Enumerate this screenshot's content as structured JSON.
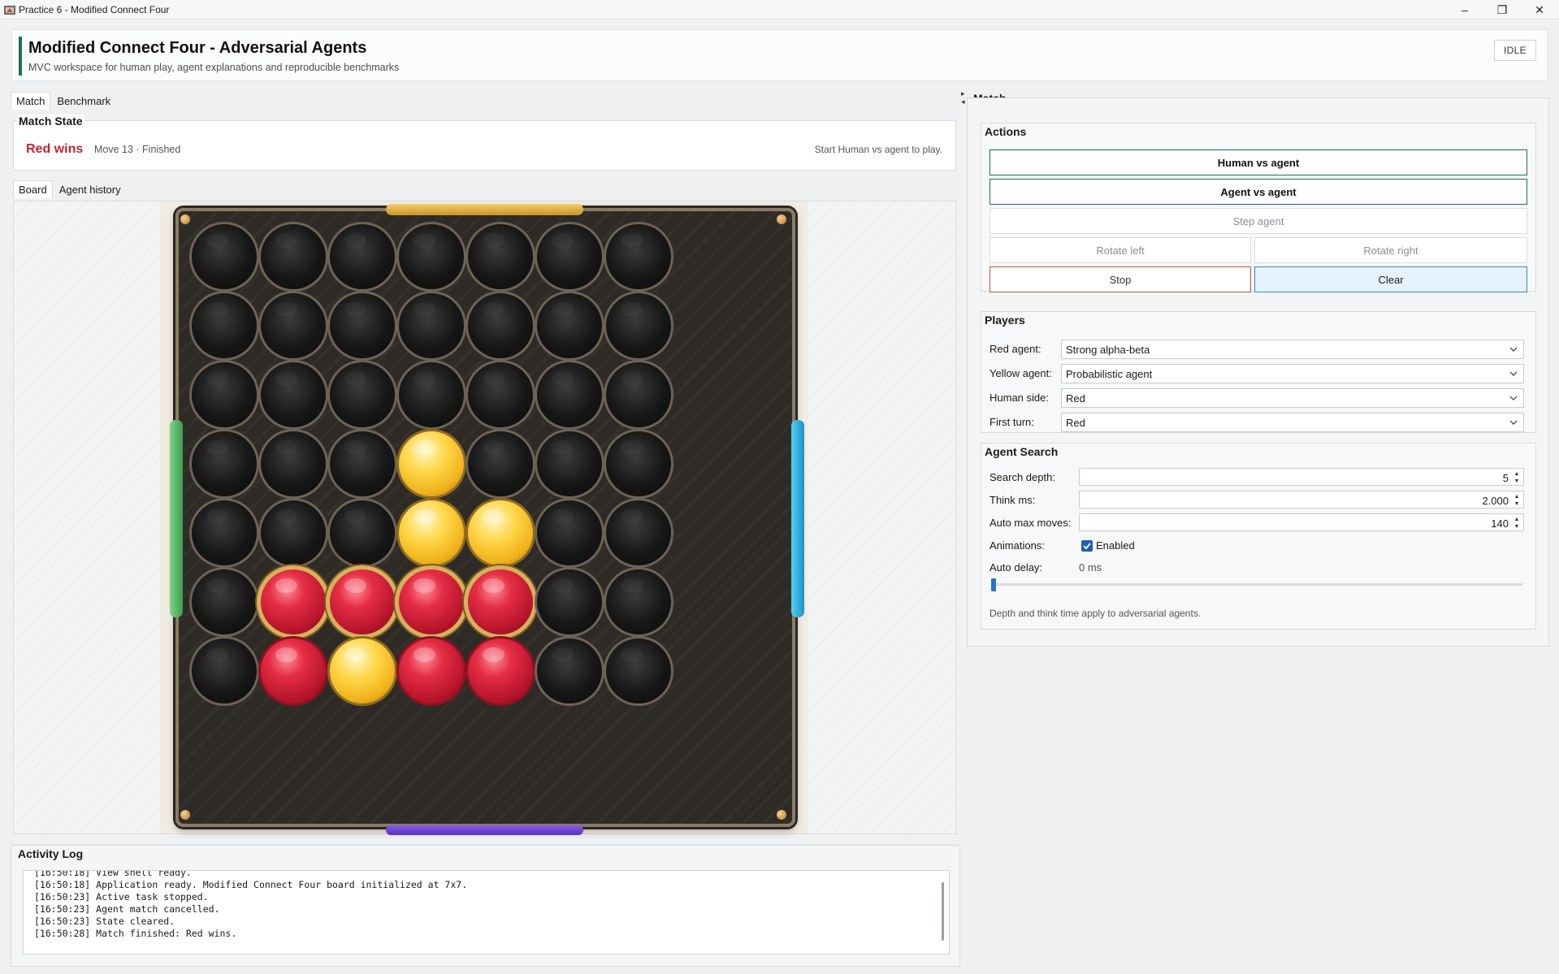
{
  "window": {
    "title": "Practice 6 - Modified Connect Four",
    "minimize": "–",
    "restore": "❐",
    "close": "✕"
  },
  "header": {
    "title": "Modified Connect Four - Adversarial Agents",
    "subtitle": "MVC workspace for human play, agent explanations and reproducible benchmarks",
    "status": "IDLE"
  },
  "main_tabs": [
    {
      "label": "Match"
    },
    {
      "label": "Benchmark"
    }
  ],
  "match_state": {
    "title": "Match State",
    "winner": "Red wins",
    "move_info": "Move 13 · Finished",
    "hint": "Start Human vs agent to play."
  },
  "board_tabs": [
    {
      "label": "Board"
    },
    {
      "label": "Agent history"
    }
  ],
  "board": {
    "columns": 7,
    "rows": 7,
    "grid": [
      [
        "e",
        "e",
        "e",
        "e",
        "e",
        "e",
        "e"
      ],
      [
        "e",
        "e",
        "e",
        "e",
        "e",
        "e",
        "e"
      ],
      [
        "e",
        "e",
        "e",
        "e",
        "e",
        "e",
        "e"
      ],
      [
        "e",
        "e",
        "e",
        "y",
        "e",
        "e",
        "e"
      ],
      [
        "e",
        "e",
        "e",
        "y",
        "y",
        "e",
        "e"
      ],
      [
        "e",
        "R",
        "R",
        "R",
        "R",
        "e",
        "e"
      ],
      [
        "e",
        "r",
        "y",
        "r",
        "r",
        "e",
        "e"
      ]
    ]
  },
  "activity_log": {
    "title": "Activity Log",
    "lines": [
      "[16:50:18] View shell ready.",
      "[16:50:18] Application ready. Modified Connect Four board initialized at 7x7.",
      "[16:50:23] Active task stopped.",
      "[16:50:23] Agent match cancelled.",
      "[16:50:23] State cleared.",
      "[16:50:28] Match finished: Red wins."
    ]
  },
  "right": {
    "title": "Match",
    "actions": {
      "title": "Actions",
      "human_vs_agent": "Human vs agent",
      "agent_vs_agent": "Agent vs agent",
      "step_agent": "Step agent",
      "rotate_left": "Rotate left",
      "rotate_right": "Rotate right",
      "stop": "Stop",
      "clear": "Clear"
    },
    "players": {
      "title": "Players",
      "red_agent_label": "Red agent:",
      "red_agent_value": "Strong alpha-beta",
      "yellow_agent_label": "Yellow agent:",
      "yellow_agent_value": "Probabilistic agent",
      "human_side_label": "Human side:",
      "human_side_value": "Red",
      "first_turn_label": "First turn:",
      "first_turn_value": "Red"
    },
    "agent_search": {
      "title": "Agent Search",
      "depth_label": "Search depth:",
      "depth_value": "5",
      "think_label": "Think ms:",
      "think_value": "2.000",
      "max_moves_label": "Auto max moves:",
      "max_moves_value": "140",
      "animations_label": "Animations:",
      "animations_value": "Enabled",
      "animations_checked": true,
      "delay_label": "Auto delay:",
      "delay_value": "0 ms",
      "delay_fraction": 0,
      "note": "Depth and think time apply to adversarial agents."
    }
  },
  "colors": {
    "accent": "#1f6e5a",
    "red_text": "#c62330",
    "clear_border": "#2a8bd0",
    "stop_border": "#b5553e"
  }
}
